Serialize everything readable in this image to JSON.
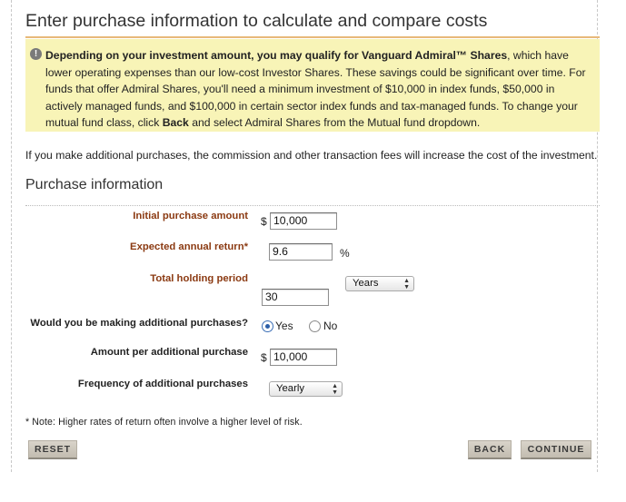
{
  "header": {
    "title": "Enter purchase information to calculate and compare costs"
  },
  "notice": {
    "bold_text": "Depending on your investment amount, you may qualify for Vanguard Admiral™ Shares",
    "text_1": ", which have lower operating expenses than our low-cost Investor Shares. These savings could be significant over time. For funds that offer Admiral Shares, you'll need a minimum investment of $10,000 in index funds, $50,000 in actively managed funds, and $100,000 in certain sector index funds and tax-managed funds. To change your mutual fund class, click ",
    "back_word": "Back",
    "text_2": " and select Admiral Shares from the Mutual fund dropdown.",
    "icon": "exclamation-icon"
  },
  "fees_note": "If you make additional purchases, the commission and other transaction fees will increase the cost of the investment.",
  "section": {
    "title": "Purchase information"
  },
  "form": {
    "initial_amount": {
      "label": "Initial purchase amount",
      "currency": "$",
      "value": "10,000"
    },
    "annual_return": {
      "label": "Expected annual return*",
      "value": "9.6",
      "unit": "%"
    },
    "holding_period": {
      "label": "Total holding period",
      "value": "30",
      "unit_selected": "Years"
    },
    "additional_purchases": {
      "label": "Would you be making additional purchases?",
      "yes": "Yes",
      "no": "No",
      "selected": "Yes"
    },
    "additional_amount": {
      "label": "Amount per additional purchase",
      "currency": "$",
      "value": "10,000"
    },
    "frequency": {
      "label": "Frequency of additional purchases",
      "selected": "Yearly"
    }
  },
  "footnote": "* Note: Higher rates of return often involve a higher level of risk.",
  "buttons": {
    "reset": "RESET",
    "back": "BACK",
    "continue": "CONTINUE"
  },
  "colors": {
    "accent_rule": "#e8b97a",
    "notice_bg": "#f8f4b7",
    "label_brown": "#8b3a12",
    "button_bg": "#cfc9bd"
  }
}
